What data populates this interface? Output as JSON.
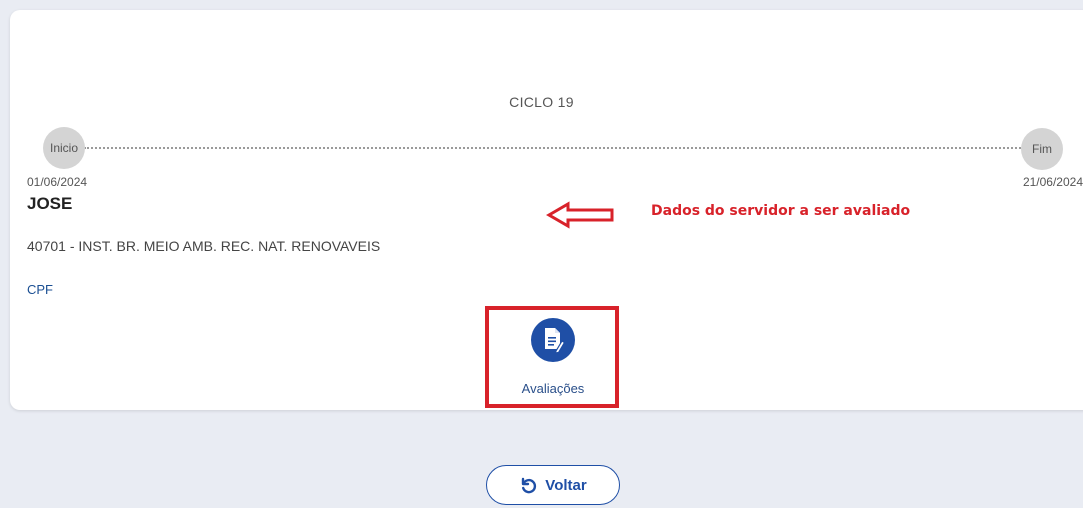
{
  "cycle": {
    "title": "CICLO 19",
    "start_label": "Inicio",
    "end_label": "Fim",
    "start_date": "01/06/2024",
    "end_date": "21/06/2024"
  },
  "server": {
    "name": "JOSE",
    "organization": "40701 - INST. BR. MEIO AMB. REC. NAT. RENOVAVEIS",
    "cpf_label": "CPF"
  },
  "annotation": {
    "text": "Dados do servidor a ser avaliado",
    "color": "#d8222a"
  },
  "actions": {
    "evaluations_label": "Avaliações",
    "evaluations_icon": "document-edit-icon",
    "back_label": "Voltar",
    "back_icon": "undo-icon"
  },
  "colors": {
    "accent": "#1f4fa6",
    "background": "#e9ecf3",
    "card": "#ffffff",
    "highlight": "#d8222a"
  }
}
